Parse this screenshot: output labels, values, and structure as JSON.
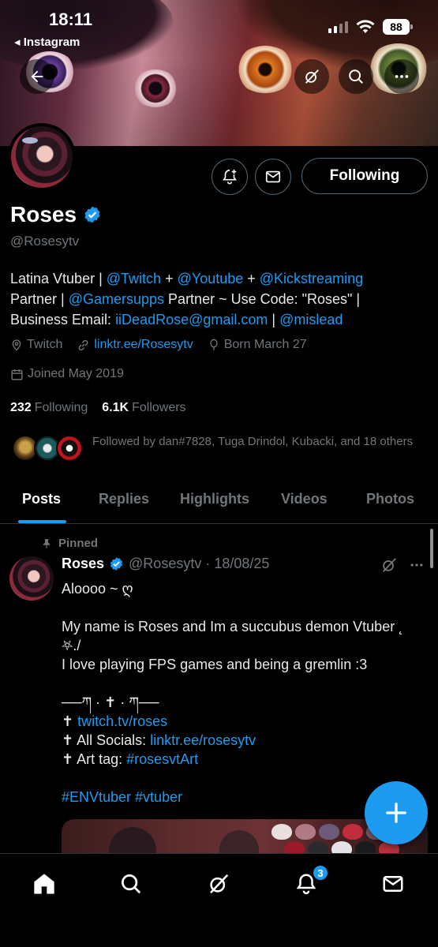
{
  "status_bar": {
    "time": "18:11",
    "back_app": "◂ Instagram",
    "battery": "88"
  },
  "profile": {
    "name": "Roses",
    "handle": "@Rosesytv",
    "following_button": "Following",
    "bio": {
      "line1": {
        "t1": "Latina Vtuber | ",
        "l1": "@Twitch",
        "t2": " + ",
        "l2": "@Youtube",
        "t3": " + ",
        "l3": "@Kickstreaming"
      },
      "line2": {
        "t1": "Partner | ",
        "l1": "@Gamersupps",
        "t2": " Partner ~ Use Code: \"Roses\" |"
      },
      "line3": {
        "t1": "Business Email: ",
        "l1": "iiDeadRose@gmail.com",
        "t2": " | ",
        "l2": "@mislead"
      }
    },
    "location": "Twitch",
    "website": "linktr.ee/Rosesytv",
    "born": "Born March 27",
    "joined": "Joined May 2019",
    "following_count": "232",
    "following_label": "Following",
    "followers_count": "6.1K",
    "followers_label": "Followers",
    "followed_by": "Followed by dan#7828, Tuga Drindol, Kubacki, and 18 others"
  },
  "tabs": [
    {
      "label": "Posts",
      "active": true
    },
    {
      "label": "Replies",
      "active": false
    },
    {
      "label": "Highlights",
      "active": false
    },
    {
      "label": "Videos",
      "active": false
    },
    {
      "label": "Photos",
      "active": false
    }
  ],
  "post": {
    "pinned_label": "Pinned",
    "author": "Roses",
    "handle_date": "@Rosesytv · 18/08/25",
    "lines": {
      "l1": "Aloooo ~ ღ",
      "l2": "",
      "l3": "My name is Roses and Im a succubus demon Vtuber ˛",
      "l4": "⛧./",
      "l5": "I love playing FPS games and being a gremlin :3",
      "l6": "",
      "l7": "──ཀ · ✝ · ཀ──",
      "l8_prefix": "✝ ",
      "l8_link": "twitch.tv/roses",
      "l9_prefix": "✝ All Socials: ",
      "l9_link": "linktr.ee/rosesytv",
      "l10_prefix": "✝ Art tag: ",
      "l10_link": "#rosesvtArt",
      "l11": "",
      "l12_link": "#ENVtuber #vtuber"
    }
  },
  "nav": {
    "notifications_badge": "3"
  },
  "colors": {
    "accent": "#1d9bf0",
    "background": "#000000",
    "muted": "#71767b",
    "text": "#e7e9ea",
    "border": "#2f3336"
  },
  "icons": [
    "back-arrow-icon",
    "grok-icon",
    "search-icon",
    "more-icon",
    "notification-add-icon",
    "mail-icon",
    "verified-icon",
    "location-icon",
    "link-icon",
    "balloon-icon",
    "calendar-icon",
    "pin-icon",
    "plus-icon",
    "home-icon",
    "bell-icon"
  ]
}
